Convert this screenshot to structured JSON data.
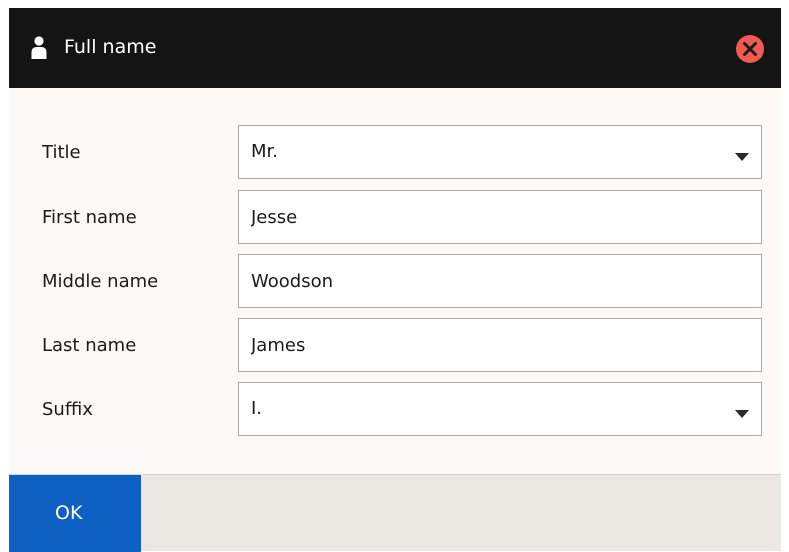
{
  "dialog": {
    "title": "Full name",
    "title_icon": "person-icon",
    "close_icon": "close-circle-icon",
    "colors": {
      "titlebar": "#141414",
      "close": "#f05a52",
      "ok_button": "#0e60c2",
      "body": "#fcf9f6",
      "footer": "#ebe7e3"
    }
  },
  "form": {
    "title": {
      "label": "Title",
      "value": "Mr."
    },
    "first_name": {
      "label": "First name",
      "value": "Jesse"
    },
    "middle_name": {
      "label": "Middle name",
      "value": "Woodson"
    },
    "last_name": {
      "label": "Last name",
      "value": "James"
    },
    "suffix": {
      "label": "Suffix",
      "value": "I."
    }
  },
  "footer": {
    "ok_label": "OK"
  }
}
